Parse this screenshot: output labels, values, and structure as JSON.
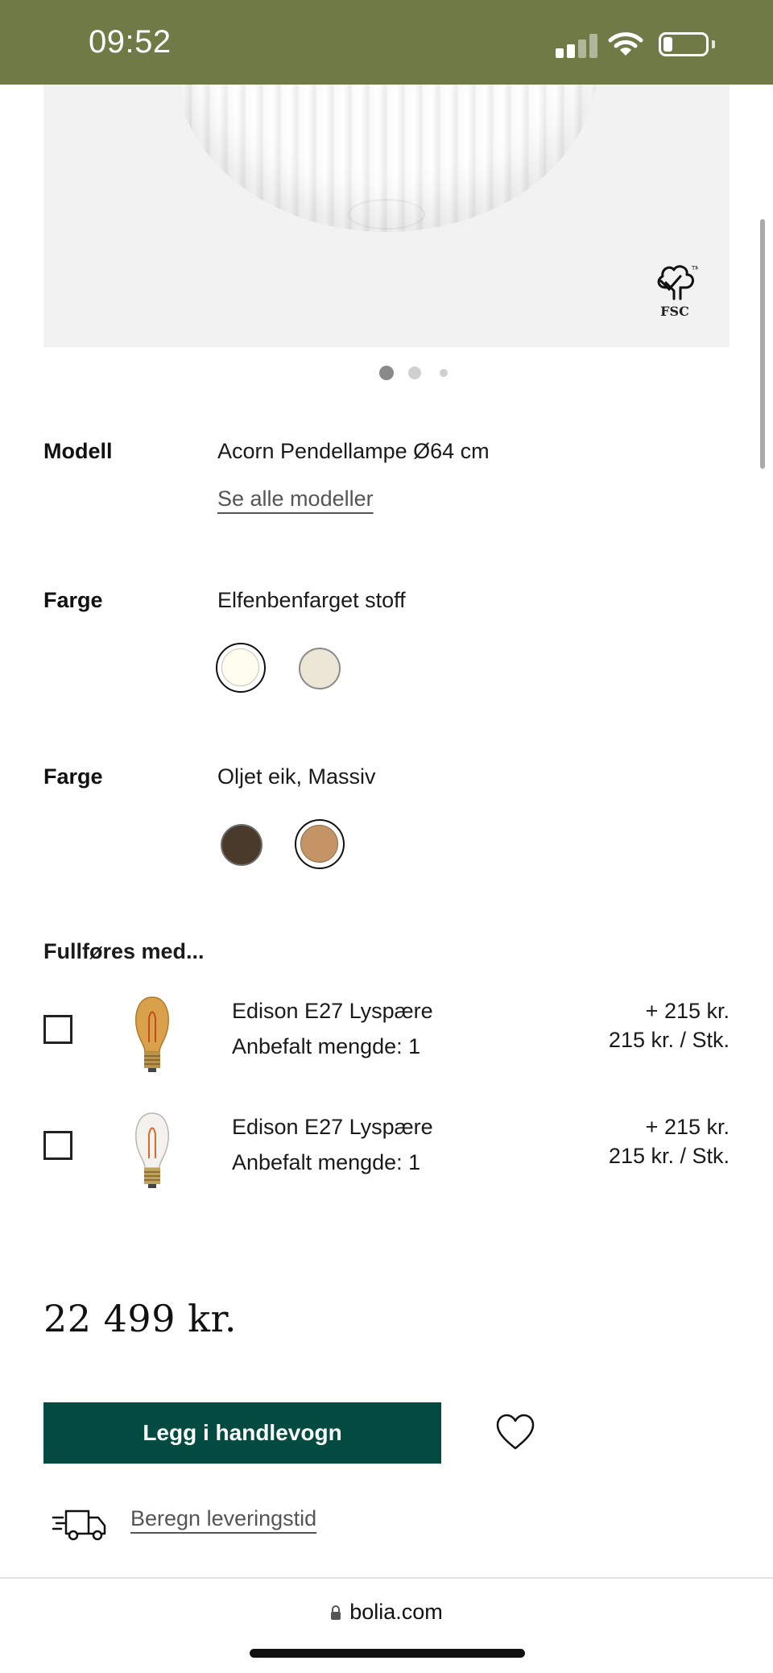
{
  "status_bar": {
    "time": "09:52"
  },
  "product": {
    "model_label": "Modell",
    "model_value": "Acorn Pendellampe Ø64 cm",
    "see_all_models": "Se alle modeller",
    "color1_label": "Farge",
    "color1_value": "Elfenbenfarget stoff",
    "color1_swatches": [
      "#fffdf0",
      "#ece6d6"
    ],
    "color2_label": "Farge",
    "color2_value": "Oljet eik, Massiv",
    "color2_swatches": [
      "#4a3a2c",
      "#c49466"
    ],
    "fsc_label": "FSC"
  },
  "addons": {
    "title": "Fullføres med...",
    "items": [
      {
        "name": "Edison E27 Lyspære",
        "qty": "Anbefalt mengde: 1",
        "price": "+ 215 kr.",
        "unit_price": "215 kr. / Stk.",
        "bulb": "amber-bulb-icon"
      },
      {
        "name": "Edison E27 Lyspære",
        "qty": "Anbefalt mengde: 1",
        "price": "+ 215 kr.",
        "unit_price": "215 kr. / Stk.",
        "bulb": "clear-bulb-icon"
      }
    ]
  },
  "price": "22 499 kr.",
  "cta": {
    "add_to_cart": "Legg i handlevogn",
    "delivery_link": "Beregn leveringstid"
  },
  "browser": {
    "url": "bolia.com"
  },
  "colors": {
    "status_bar": "#6f7a47",
    "cta": "#034a41"
  }
}
